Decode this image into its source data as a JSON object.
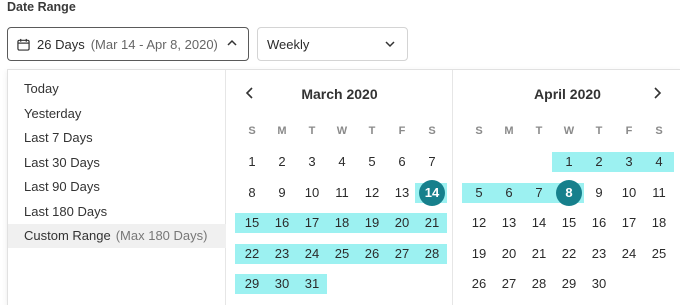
{
  "header": {
    "title": "Date Range",
    "range_label": "26 Days",
    "range_detail": "(Mar 14 - Apr 8, 2020)",
    "granularity": "Weekly"
  },
  "presets": [
    {
      "label": "Today",
      "note": ""
    },
    {
      "label": "Yesterday",
      "note": ""
    },
    {
      "label": "Last 7 Days",
      "note": ""
    },
    {
      "label": "Last 30 Days",
      "note": ""
    },
    {
      "label": "Last 90 Days",
      "note": ""
    },
    {
      "label": "Last 180 Days",
      "note": ""
    },
    {
      "label": "Custom Range",
      "note": "(Max 180 Days)"
    }
  ],
  "active_preset": 6,
  "weekdays": [
    "S",
    "M",
    "T",
    "W",
    "T",
    "F",
    "S"
  ],
  "months": [
    {
      "title": "March 2020",
      "first_weekday": 0,
      "days": 31,
      "range_start": 14,
      "range_end": 31,
      "endpoint": 14,
      "nav": "prev"
    },
    {
      "title": "April 2020",
      "first_weekday": 3,
      "days": 30,
      "range_start": 1,
      "range_end": 8,
      "endpoint": 8,
      "nav": "next"
    }
  ],
  "colors": {
    "accent": "#17808c",
    "range": "#9cf1f1"
  },
  "icons": {
    "calendar": "calendar-icon",
    "chevron_up": "chevron-up-icon",
    "chevron_down": "chevron-down-icon",
    "prev": "chevron-left-icon",
    "next": "chevron-right-icon"
  }
}
